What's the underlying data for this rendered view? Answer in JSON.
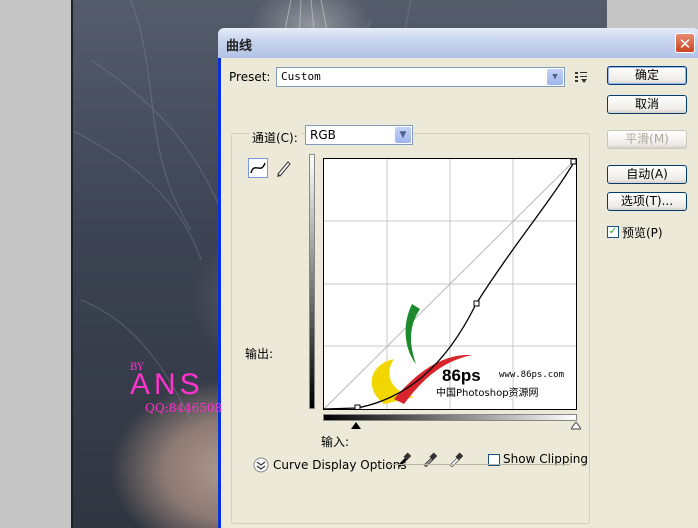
{
  "background": {
    "watermark_by": "BY",
    "watermark_name": "ANS",
    "watermark_qq": "QQ:8446508"
  },
  "dialog": {
    "title": "曲线",
    "close_glyph": "✕",
    "preset": {
      "label": "Preset:",
      "value": "Custom"
    },
    "channel": {
      "label": "通道(C):",
      "value": "RGB"
    },
    "buttons": {
      "ok": "确定",
      "cancel": "取消",
      "smooth": "平滑(M)",
      "auto": "自动(A)",
      "options": "选项(T)..."
    },
    "preview": {
      "label": "预览(P)",
      "checked": true
    },
    "output_label": "输出:",
    "input_label": "输入:",
    "show_clipping": {
      "label": "Show Clipping",
      "checked": false
    },
    "curve_display_options": "Curve Display Options",
    "watermark_logo": {
      "text_86ps": "86ps",
      "url": "www.86ps.com",
      "site_name": "中国Photoshop资源网"
    }
  },
  "colors": {
    "title_bar_blue": "#0831d9",
    "dialog_face": "#ece9d8",
    "watermark_pink": "#ff33cc",
    "logo_green": "#1e8a2e",
    "logo_red": "#d8242c",
    "logo_yellow": "#f2d600"
  },
  "icons": [
    "curve-point-tool-icon",
    "pencil-tool-icon",
    "preset-options-icon",
    "black-eyedropper-icon",
    "gray-eyedropper-icon",
    "white-eyedropper-icon",
    "expand-chevron-icon"
  ]
}
